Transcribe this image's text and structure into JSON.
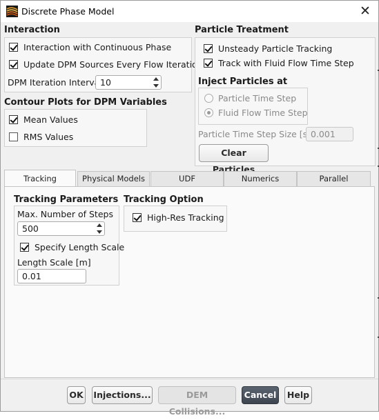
{
  "window": {
    "title": "Discrete Phase Model",
    "close_label": "✕"
  },
  "interaction": {
    "title": "Interaction",
    "continuous_phase": "Interaction with Continuous Phase",
    "update_sources": "Update DPM Sources Every Flow Iteration",
    "interval_label": "DPM Iteration Interval",
    "interval_value": "10"
  },
  "contour": {
    "title": "Contour Plots for DPM Variables",
    "mean_values": "Mean Values",
    "rms_values": "RMS Values"
  },
  "particle_treatment": {
    "title": "Particle Treatment",
    "unsteady": "Unsteady Particle Tracking",
    "track_fluid": "Track with Fluid Flow Time Step"
  },
  "inject": {
    "title": "Inject Particles at",
    "particle_time_step": "Particle Time Step",
    "fluid_flow_time_step": "Fluid Flow Time Step",
    "step_size_label": "Particle Time Step Size [s]",
    "step_size_value": "0.001",
    "clear_button": "Clear Particles"
  },
  "tabs": [
    {
      "label": "Tracking"
    },
    {
      "label": "Physical Models"
    },
    {
      "label": "UDF"
    },
    {
      "label": "Numerics"
    },
    {
      "label": "Parallel"
    }
  ],
  "tracking": {
    "params_title": "Tracking Parameters",
    "max_steps_label": "Max. Number of Steps",
    "max_steps_value": "500",
    "specify_length": "Specify Length Scale",
    "length_label": "Length Scale [m]",
    "length_value": "0.01",
    "option_title": "Tracking Option",
    "high_res": "High-Res Tracking"
  },
  "footer": {
    "ok": "OK",
    "injections": "Injections...",
    "dem": "DEM Collisions...",
    "cancel": "Cancel",
    "help": "Help"
  }
}
